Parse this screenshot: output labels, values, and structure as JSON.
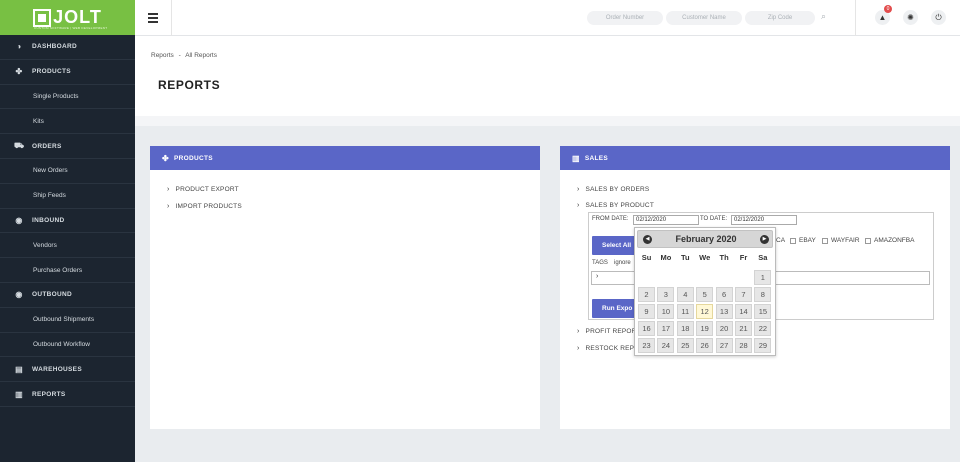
{
  "logo": {
    "text": "JOLT",
    "tagline": "CUSTOM SOFTWARE | WEB DEVELOPMENT"
  },
  "sidebar": {
    "items": [
      {
        "label": "DASHBOARD",
        "type": "main",
        "icon": "dashboard-icon",
        "glyph": "◑"
      },
      {
        "label": "PRODUCTS",
        "type": "main",
        "icon": "products-icon",
        "glyph": "✤"
      },
      {
        "label": "Single Products",
        "type": "sub"
      },
      {
        "label": "Kits",
        "type": "sub"
      },
      {
        "label": "ORDERS",
        "type": "main",
        "icon": "cart-icon",
        "glyph": "⛟"
      },
      {
        "label": "New Orders",
        "type": "sub"
      },
      {
        "label": "Ship Feeds",
        "type": "sub"
      },
      {
        "label": "INBOUND",
        "type": "main",
        "icon": "inbound-icon",
        "glyph": "◉"
      },
      {
        "label": "Vendors",
        "type": "sub"
      },
      {
        "label": "Purchase Orders",
        "type": "sub"
      },
      {
        "label": "OUTBOUND",
        "type": "main",
        "icon": "outbound-icon",
        "glyph": "◉"
      },
      {
        "label": "Outbound Shipments",
        "type": "sub"
      },
      {
        "label": "Outbound Workflow",
        "type": "sub"
      },
      {
        "label": "WAREHOUSES",
        "type": "main",
        "icon": "warehouse-icon",
        "glyph": "▤"
      },
      {
        "label": "REPORTS",
        "type": "main",
        "icon": "reports-icon",
        "glyph": "▥"
      }
    ]
  },
  "topbar": {
    "order_placeholder": "Order Number",
    "customer_placeholder": "Customer Name",
    "zip_placeholder": "Zip Code",
    "notif_count": "0"
  },
  "breadcrumb": {
    "root": "Reports",
    "sep": "-",
    "current": "All Reports"
  },
  "page": {
    "title": "REPORTS"
  },
  "products_panel": {
    "title": "PRODUCTS",
    "items": [
      "PRODUCT EXPORT",
      "IMPORT PRODUCTS"
    ]
  },
  "sales_panel": {
    "title": "SALES",
    "items": [
      "SALES BY ORDERS",
      "SALES BY PRODUCT",
      "PROFIT REPORT",
      "RESTOCK REP"
    ],
    "from_label": "FROM DATE:",
    "from_value": "02/12/2020",
    "to_label": "TO DATE:",
    "to_value": "02/12/2020",
    "select_all": "Select All",
    "channels": [
      "CA",
      "EBAY",
      "WAYFAIR",
      "AMAZONFBA"
    ],
    "tags_label": "TAGS",
    "tags_value": "ignore",
    "run_label": "Run Expo"
  },
  "calendar": {
    "month": "February 2020",
    "dow": [
      "Su",
      "Mo",
      "Tu",
      "We",
      "Th",
      "Fr",
      "Sa"
    ],
    "weeks": [
      [
        "",
        "",
        "",
        "",
        "",
        "",
        "1"
      ],
      [
        "2",
        "3",
        "4",
        "5",
        "6",
        "7",
        "8"
      ],
      [
        "9",
        "10",
        "11",
        "12",
        "13",
        "14",
        "15"
      ],
      [
        "16",
        "17",
        "18",
        "19",
        "20",
        "21",
        "22"
      ],
      [
        "23",
        "24",
        "25",
        "26",
        "27",
        "28",
        "29"
      ]
    ],
    "today": "12"
  }
}
